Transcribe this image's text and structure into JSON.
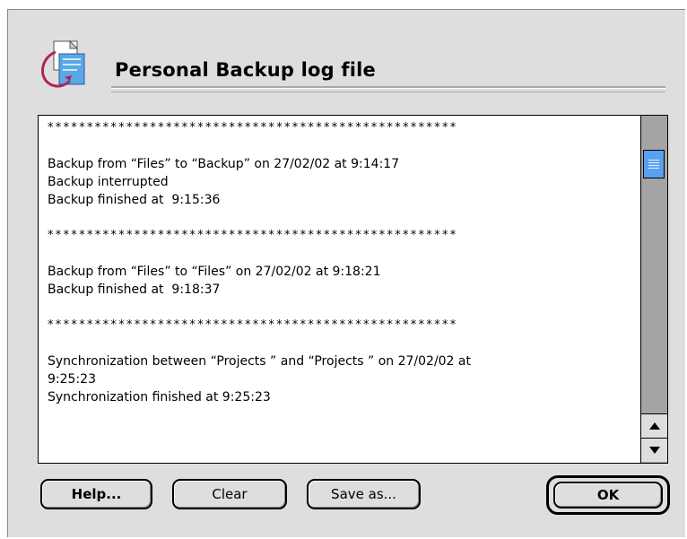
{
  "dialog": {
    "title": "Personal Backup log file",
    "icon": "personal-backup-app-icon"
  },
  "log": {
    "lines": [
      {
        "text": "****************************************************",
        "kind": "stars"
      },
      {
        "text": "",
        "kind": "blank"
      },
      {
        "text": "Backup from “Files” to “Backup” on 27/02/02 at 9:14:17",
        "kind": "text"
      },
      {
        "text": "Backup interrupted",
        "kind": "text"
      },
      {
        "text": "Backup finished at  9:15:36",
        "kind": "text"
      },
      {
        "text": "",
        "kind": "blank"
      },
      {
        "text": "****************************************************",
        "kind": "stars"
      },
      {
        "text": "",
        "kind": "blank"
      },
      {
        "text": "Backup from “Files” to “Files” on 27/02/02 at 9:18:21",
        "kind": "text"
      },
      {
        "text": "Backup finished at  9:18:37",
        "kind": "text"
      },
      {
        "text": "",
        "kind": "blank"
      },
      {
        "text": "****************************************************",
        "kind": "stars"
      },
      {
        "text": "",
        "kind": "blank"
      },
      {
        "text": "Synchronization between “Projects ” and “Projects ” on 27/02/02 at",
        "kind": "text"
      },
      {
        "text": "9:25:23",
        "kind": "text"
      },
      {
        "text": "Synchronization finished at 9:25:23",
        "kind": "text"
      }
    ]
  },
  "scrollbar": {
    "thumb_color": "#58a0f0",
    "scroll_position": 0.05
  },
  "buttons": {
    "help": "Help...",
    "clear": "Clear",
    "save_as": "Save as...",
    "ok": "OK"
  }
}
